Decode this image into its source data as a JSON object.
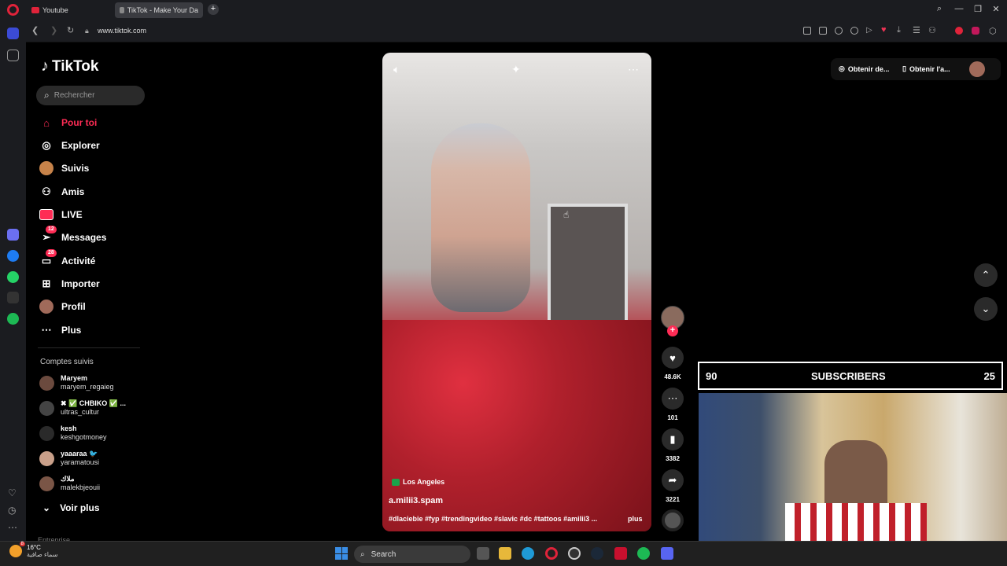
{
  "browser": {
    "tabs": [
      {
        "label": "Youtube"
      },
      {
        "label": "TikTok - Make Your Da"
      }
    ],
    "new_tab": "+",
    "url": "www.tiktok.com"
  },
  "tiktok": {
    "logo": "TikTok",
    "search_placeholder": "Rechercher",
    "nav": [
      {
        "label": "Pour toi",
        "icon": "home-icon"
      },
      {
        "label": "Explorer",
        "icon": "compass-icon"
      },
      {
        "label": "Suivis",
        "icon": "following-avatar"
      },
      {
        "label": "Amis",
        "icon": "friends-icon"
      },
      {
        "label": "LIVE",
        "icon": "live-icon"
      },
      {
        "label": "Messages",
        "icon": "messages-icon",
        "badge": "12"
      },
      {
        "label": "Activité",
        "icon": "activity-icon",
        "badge": "28"
      },
      {
        "label": "Importer",
        "icon": "upload-icon"
      },
      {
        "label": "Profil",
        "icon": "profile-avatar"
      },
      {
        "label": "Plus",
        "icon": "more-icon"
      }
    ],
    "following_title": "Comptes suivis",
    "following": [
      {
        "name": "Maryem",
        "user": "maryem_regaieg"
      },
      {
        "name": "✖ ✅ CHBIKO ✅ ...",
        "user": "ultras_cultur"
      },
      {
        "name": "kesh",
        "user": "keshgotmoney"
      },
      {
        "name": "yaaaraa 🐦",
        "user": "yaramatousi"
      },
      {
        "name": "ملاك",
        "user": "malekbjeouii"
      }
    ],
    "see_more": "Voir plus",
    "footer_cut": "Entreprise",
    "video": {
      "location": "Los Angeles",
      "username": "a.milii3.spam",
      "tags": "#dlaciebie #fyp #trendingvideo #slavic #dc #tattoos #amilii3 ...",
      "more": "plus"
    },
    "actions": {
      "likes": "48.6K",
      "comments": "101",
      "saves": "3382",
      "shares": "3221"
    },
    "top_actions": {
      "get_coins": "Obtenir de...",
      "get_app": "Obtenir l'a..."
    }
  },
  "overlay": {
    "left_count": "90",
    "title": "SUBSCRIBERS",
    "right_count": "25"
  },
  "taskbar": {
    "temp": "16°C",
    "weather_text": "سماء صافية",
    "weather_badge": "8",
    "search": "Search"
  }
}
